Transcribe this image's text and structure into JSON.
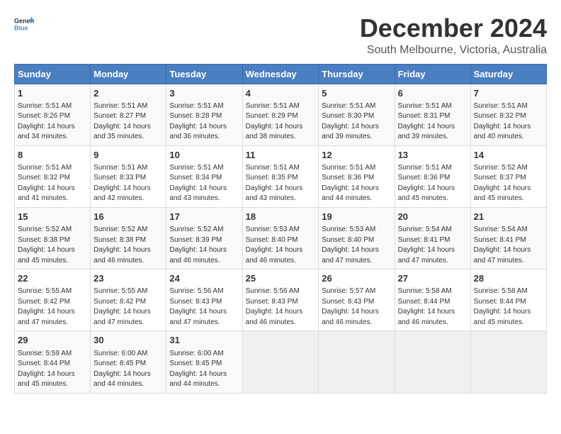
{
  "logo": {
    "general": "General",
    "blue": "Blue"
  },
  "header": {
    "month": "December 2024",
    "location": "South Melbourne, Victoria, Australia"
  },
  "weekdays": [
    "Sunday",
    "Monday",
    "Tuesday",
    "Wednesday",
    "Thursday",
    "Friday",
    "Saturday"
  ],
  "weeks": [
    [
      {
        "day": "1",
        "info": "Sunrise: 5:51 AM\nSunset: 8:26 PM\nDaylight: 14 hours\nand 34 minutes."
      },
      {
        "day": "2",
        "info": "Sunrise: 5:51 AM\nSunset: 8:27 PM\nDaylight: 14 hours\nand 35 minutes."
      },
      {
        "day": "3",
        "info": "Sunrise: 5:51 AM\nSunset: 8:28 PM\nDaylight: 14 hours\nand 36 minutes."
      },
      {
        "day": "4",
        "info": "Sunrise: 5:51 AM\nSunset: 8:29 PM\nDaylight: 14 hours\nand 38 minutes."
      },
      {
        "day": "5",
        "info": "Sunrise: 5:51 AM\nSunset: 8:30 PM\nDaylight: 14 hours\nand 39 minutes."
      },
      {
        "day": "6",
        "info": "Sunrise: 5:51 AM\nSunset: 8:31 PM\nDaylight: 14 hours\nand 39 minutes."
      },
      {
        "day": "7",
        "info": "Sunrise: 5:51 AM\nSunset: 8:32 PM\nDaylight: 14 hours\nand 40 minutes."
      }
    ],
    [
      {
        "day": "8",
        "info": "Sunrise: 5:51 AM\nSunset: 8:32 PM\nDaylight: 14 hours\nand 41 minutes."
      },
      {
        "day": "9",
        "info": "Sunrise: 5:51 AM\nSunset: 8:33 PM\nDaylight: 14 hours\nand 42 minutes."
      },
      {
        "day": "10",
        "info": "Sunrise: 5:51 AM\nSunset: 8:34 PM\nDaylight: 14 hours\nand 43 minutes."
      },
      {
        "day": "11",
        "info": "Sunrise: 5:51 AM\nSunset: 8:35 PM\nDaylight: 14 hours\nand 43 minutes."
      },
      {
        "day": "12",
        "info": "Sunrise: 5:51 AM\nSunset: 8:36 PM\nDaylight: 14 hours\nand 44 minutes."
      },
      {
        "day": "13",
        "info": "Sunrise: 5:51 AM\nSunset: 8:36 PM\nDaylight: 14 hours\nand 45 minutes."
      },
      {
        "day": "14",
        "info": "Sunrise: 5:52 AM\nSunset: 8:37 PM\nDaylight: 14 hours\nand 45 minutes."
      }
    ],
    [
      {
        "day": "15",
        "info": "Sunrise: 5:52 AM\nSunset: 8:38 PM\nDaylight: 14 hours\nand 45 minutes."
      },
      {
        "day": "16",
        "info": "Sunrise: 5:52 AM\nSunset: 8:38 PM\nDaylight: 14 hours\nand 46 minutes."
      },
      {
        "day": "17",
        "info": "Sunrise: 5:52 AM\nSunset: 8:39 PM\nDaylight: 14 hours\nand 46 minutes."
      },
      {
        "day": "18",
        "info": "Sunrise: 5:53 AM\nSunset: 8:40 PM\nDaylight: 14 hours\nand 46 minutes."
      },
      {
        "day": "19",
        "info": "Sunrise: 5:53 AM\nSunset: 8:40 PM\nDaylight: 14 hours\nand 47 minutes."
      },
      {
        "day": "20",
        "info": "Sunrise: 5:54 AM\nSunset: 8:41 PM\nDaylight: 14 hours\nand 47 minutes."
      },
      {
        "day": "21",
        "info": "Sunrise: 5:54 AM\nSunset: 8:41 PM\nDaylight: 14 hours\nand 47 minutes."
      }
    ],
    [
      {
        "day": "22",
        "info": "Sunrise: 5:55 AM\nSunset: 8:42 PM\nDaylight: 14 hours\nand 47 minutes."
      },
      {
        "day": "23",
        "info": "Sunrise: 5:55 AM\nSunset: 8:42 PM\nDaylight: 14 hours\nand 47 minutes."
      },
      {
        "day": "24",
        "info": "Sunrise: 5:56 AM\nSunset: 8:43 PM\nDaylight: 14 hours\nand 47 minutes."
      },
      {
        "day": "25",
        "info": "Sunrise: 5:56 AM\nSunset: 8:43 PM\nDaylight: 14 hours\nand 46 minutes."
      },
      {
        "day": "26",
        "info": "Sunrise: 5:57 AM\nSunset: 8:43 PM\nDaylight: 14 hours\nand 46 minutes."
      },
      {
        "day": "27",
        "info": "Sunrise: 5:58 AM\nSunset: 8:44 PM\nDaylight: 14 hours\nand 46 minutes."
      },
      {
        "day": "28",
        "info": "Sunrise: 5:58 AM\nSunset: 8:44 PM\nDaylight: 14 hours\nand 45 minutes."
      }
    ],
    [
      {
        "day": "29",
        "info": "Sunrise: 5:59 AM\nSunset: 8:44 PM\nDaylight: 14 hours\nand 45 minutes."
      },
      {
        "day": "30",
        "info": "Sunrise: 6:00 AM\nSunset: 8:45 PM\nDaylight: 14 hours\nand 44 minutes."
      },
      {
        "day": "31",
        "info": "Sunrise: 6:00 AM\nSunset: 8:45 PM\nDaylight: 14 hours\nand 44 minutes."
      },
      null,
      null,
      null,
      null
    ]
  ]
}
